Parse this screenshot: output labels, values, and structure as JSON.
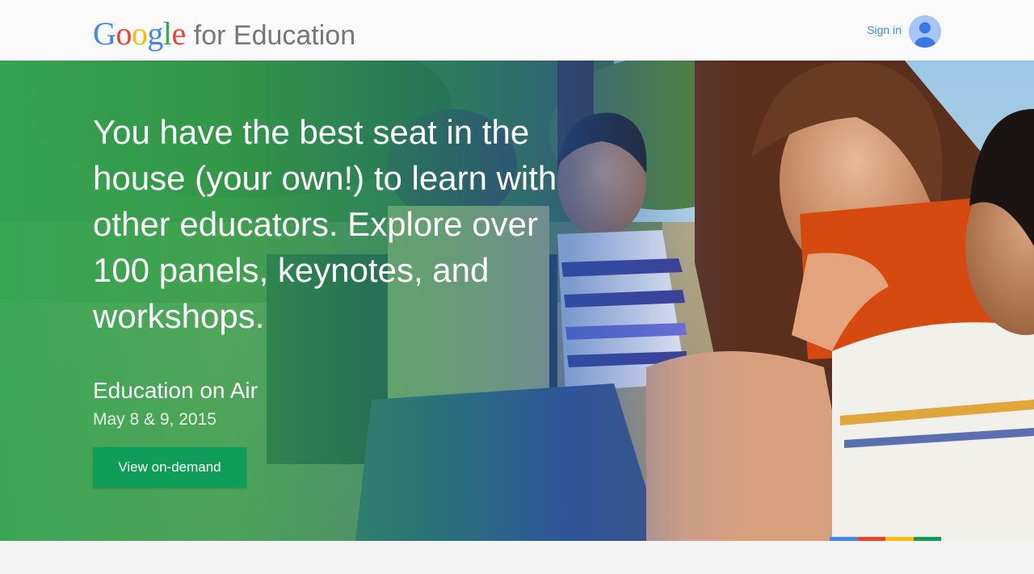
{
  "header": {
    "logo": {
      "letters": [
        {
          "char": "G",
          "color": "#4285f4"
        },
        {
          "char": "o",
          "color": "#ea4335"
        },
        {
          "char": "o",
          "color": "#fbbc05"
        },
        {
          "char": "g",
          "color": "#4285f4"
        },
        {
          "char": "l",
          "color": "#34a853"
        },
        {
          "char": "e",
          "color": "#ea4335"
        }
      ],
      "product": "for Education"
    },
    "signin_label": "Sign in",
    "avatar_icon": "person-icon"
  },
  "hero": {
    "headline": "You have the best seat in the house (your own!) to learn with other educators. Explore over 100 panels, keynotes, and workshops.",
    "event_name": "Education on Air",
    "event_date": "May 8 & 9, 2015",
    "cta_label": "View on-demand",
    "photo": "children-learning-outdoors"
  },
  "colors": {
    "brand_blue": "#4285f4",
    "brand_red": "#ea4335",
    "brand_yellow": "#fbbc05",
    "brand_green": "#34a853",
    "cta_green": "#0f9d58"
  },
  "color_strip": [
    "#4285f4",
    "#ea4335",
    "#fbbc05",
    "#0f9d58"
  ]
}
